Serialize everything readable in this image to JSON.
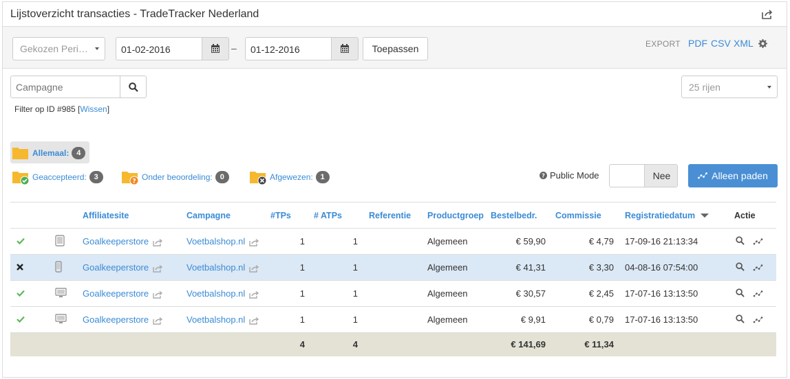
{
  "header": {
    "title": "Lijstoverzicht transacties - TradeTracker Nederland"
  },
  "toolbar": {
    "period_select": "Gekozen Peri…",
    "date_from": "01-02-2016",
    "date_sep": "–",
    "date_to": "01-12-2016",
    "apply_label": "Toepassen",
    "export_label": "EXPORT",
    "export_pdf": "PDF",
    "export_csv": "CSV",
    "export_xml": "XML"
  },
  "search": {
    "placeholder": "Campagne",
    "rows_select": "25 rijen"
  },
  "filter": {
    "text": "Filter op ID #985 [",
    "clear": "Wissen",
    "close": "]"
  },
  "folders": {
    "all": {
      "label": "Allemaal:",
      "count": "4"
    },
    "accepted": {
      "label": "Geaccepteerd:",
      "count": "3"
    },
    "pending": {
      "label": "Onder beoordeling:",
      "count": "0"
    },
    "rejected": {
      "label": "Afgewezen:",
      "count": "1"
    }
  },
  "public_mode": {
    "label": "Public Mode",
    "value": "Nee"
  },
  "paths_button": "Alleen paden",
  "table": {
    "headers": {
      "affiliate": "Affiliatesite",
      "campaign": "Campagne",
      "tps": "#TPs",
      "atps": "# ATPs",
      "reference": "Referentie",
      "productgroup": "Productgroep",
      "order": "Bestelbedr.",
      "commission": "Commissie",
      "date": "Registratiedatum",
      "action": "Actie"
    },
    "rows": [
      {
        "status": "accepted",
        "device": "tablet",
        "affiliate": "Goalkeeperstore",
        "campaign": "Voetbalshop.nl",
        "tps": "1",
        "atps": "1",
        "reference": "",
        "productgroup": "Algemeen",
        "order": "€ 59,90",
        "commission": "€ 4,79",
        "date": "17-09-16 21:13:34"
      },
      {
        "status": "rejected",
        "device": "mobile",
        "affiliate": "Goalkeeperstore",
        "campaign": "Voetbalshop.nl",
        "tps": "1",
        "atps": "1",
        "reference": "",
        "productgroup": "Algemeen",
        "order": "€ 41,31",
        "commission": "€ 3,30",
        "date": "04-08-16 07:54:00"
      },
      {
        "status": "accepted",
        "device": "desktop",
        "affiliate": "Goalkeeperstore",
        "campaign": "Voetbalshop.nl",
        "tps": "1",
        "atps": "1",
        "reference": "",
        "productgroup": "Algemeen",
        "order": "€ 30,57",
        "commission": "€ 2,45",
        "date": "17-07-16 13:13:50"
      },
      {
        "status": "accepted",
        "device": "desktop",
        "affiliate": "Goalkeeperstore",
        "campaign": "Voetbalshop.nl",
        "tps": "1",
        "atps": "1",
        "reference": "",
        "productgroup": "Algemeen",
        "order": "€ 9,91",
        "commission": "€ 0,79",
        "date": "17-07-16 13:13:50"
      }
    ],
    "totals": {
      "tps": "4",
      "atps": "4",
      "order": "€ 141,69",
      "commission": "€ 11,34"
    }
  },
  "colors": {
    "link": "#3a8bd6",
    "accent": "#4a8fd4",
    "check": "#5cb85c",
    "highlight": "#dbe8f5",
    "total_bg": "#e3e2d5"
  }
}
